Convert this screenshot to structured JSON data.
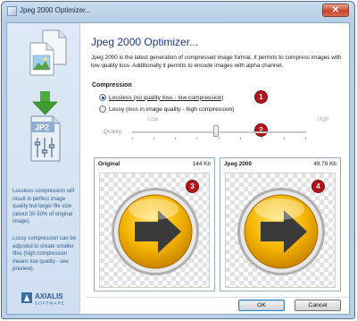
{
  "window": {
    "title": "Jpeg 2000 Optimizer...",
    "close_label": "✕"
  },
  "sidebar": {
    "icons": [
      "document-image-icon",
      "download-arrow-icon",
      "jp2-file-icon",
      "sliders-icon"
    ],
    "jp2_label": "JP2",
    "paragraph_1": "Lossless compression will result in perfect image quality but larger file size (about 30-50% of original image).",
    "paragraph_2": "Lossy compression can be adjusted to create smaller files (high compression means low quality - see preview).",
    "logo_line1": "AXIALIS",
    "logo_line2": "SOFTWARE"
  },
  "main": {
    "heading": "Jpeg 2000 Optimizer...",
    "description": "Jpeg 2000 is the latest generation of compressed image format. It permits to compress images with low quality loss. Additionally it permits to encode images with alpha channel.",
    "compression": {
      "title": "Compression",
      "options": [
        {
          "label": "Lossless (no quality loss - low compression)",
          "selected": true
        },
        {
          "label": "Lossy (loss in image quality - high compression)",
          "selected": false
        }
      ]
    },
    "quality": {
      "label": "Quality:",
      "low_label": "Low",
      "high_label": "High",
      "value_fraction": 0.47,
      "enabled": false
    },
    "previews": [
      {
        "title": "Original",
        "size": "144 Kb",
        "badge": "3"
      },
      {
        "title": "Jpeg 2000",
        "size": "48.78 Kb",
        "badge": "4"
      }
    ],
    "badges": [
      "1",
      "2"
    ],
    "buttons": {
      "ok": "OK",
      "cancel": "Cancel"
    }
  },
  "colors": {
    "accent_heading": "#1e3a8a",
    "badge_red": "#b4151b",
    "sidebar_text": "#2f5c8f",
    "arrow_orb": "#f2b705"
  }
}
